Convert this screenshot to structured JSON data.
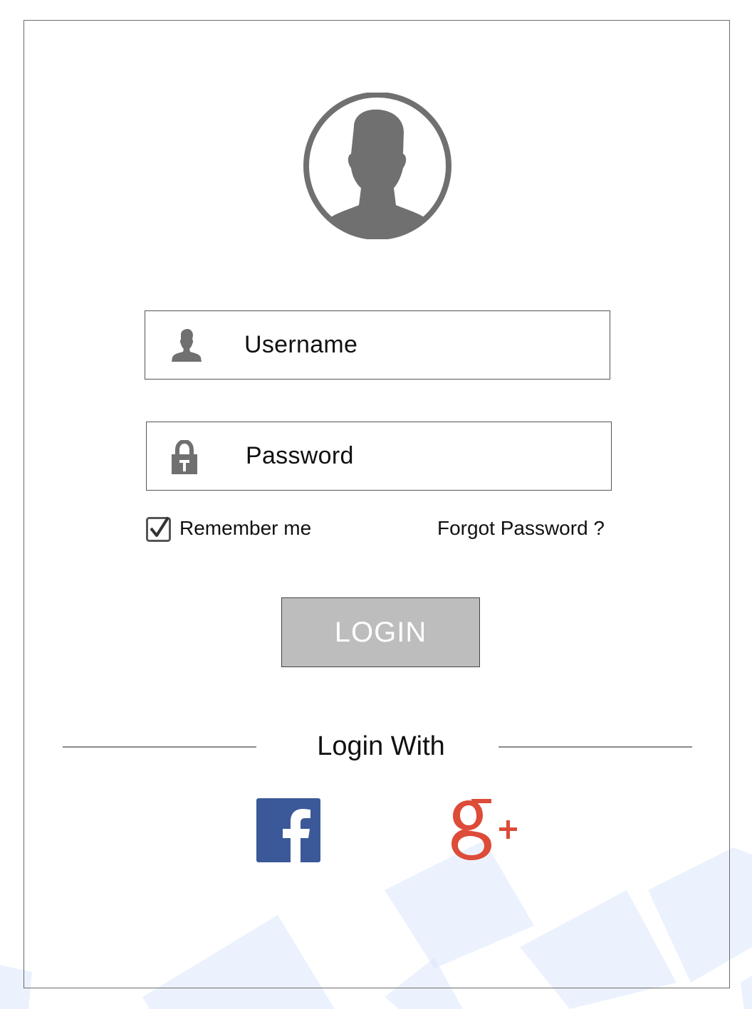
{
  "form": {
    "username_placeholder": "Username",
    "password_placeholder": "Password",
    "remember_label": "Remember me",
    "remember_checked": true,
    "forgot_label": "Forgot Password ?",
    "login_label": "LOGIN"
  },
  "social": {
    "heading": "Login With",
    "providers": [
      {
        "name": "facebook-icon",
        "glyph": "f",
        "color": "#3b5998"
      },
      {
        "name": "google-plus-icon",
        "glyph": "g+",
        "color": "#dd4b39"
      }
    ]
  },
  "colors": {
    "icon_gray": "#707070",
    "button_bg": "#bdbdbd",
    "decor_blue": "#dbe8fb"
  }
}
